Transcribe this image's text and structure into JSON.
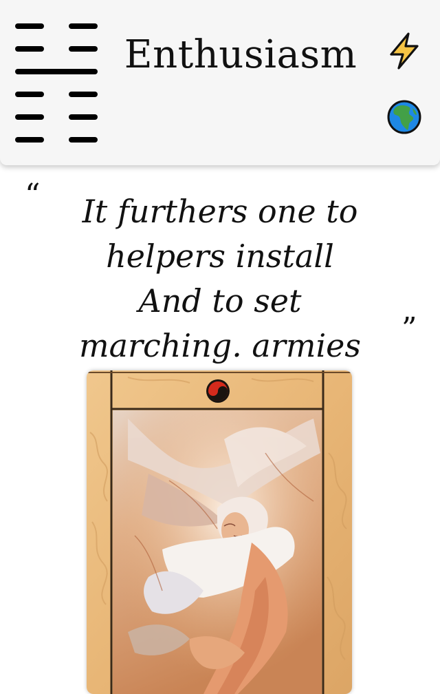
{
  "header": {
    "title": "Enthusiasm",
    "hexagram": [
      "broken",
      "broken",
      "solid",
      "broken",
      "broken",
      "broken"
    ],
    "icons": {
      "energy": "lightning-bolt-icon",
      "language": "globe-icon"
    }
  },
  "verse": {
    "open_quote": "“",
    "close_quote": "”",
    "lines": [
      "It furthers one to",
      "helpers install",
      "And to set",
      "marching. armies"
    ]
  },
  "card": {
    "emblem": "yin-yang-emblem",
    "colors": {
      "frame": "#e9b97a",
      "dark_border": "#3a2a1a",
      "emblem_red": "#d42a1c"
    }
  }
}
